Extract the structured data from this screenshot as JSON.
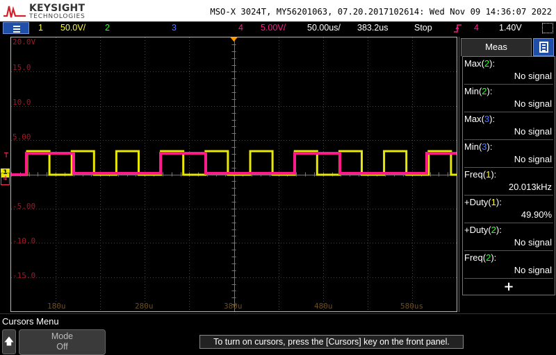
{
  "header": {
    "brand": "KEYSIGHT",
    "brand_sub": "TECHNOLOGIES",
    "instrument": "MSO-X 3024T, MY56201063, 07.20.2017102614: Wed Nov 09 14:36:07 2022"
  },
  "status_bar": {
    "ch1_num": "1",
    "ch1_scale": "50.0V/",
    "ch2_num": "2",
    "ch3_num": "3",
    "ch4_num": "4",
    "ch4_scale": "5.00V/",
    "timebase": "50.00us/",
    "delay": "383.2us",
    "run_state": "Stop",
    "trigger_channel": "4",
    "trigger_level": "1.40V"
  },
  "graticule": {
    "y_labels": [
      "20.0V",
      "15.0",
      "10.0",
      "5.00",
      "-5.00",
      "-10.0",
      "-15.0"
    ],
    "x_labels": [
      "180u",
      "280u",
      "380u",
      "480u",
      "580us"
    ],
    "ch1_marker": "1",
    "ch4_marker": "4",
    "trig_marker": "T"
  },
  "colors": {
    "ch1": "#ffff33",
    "ch2": "#33ff33",
    "ch3": "#5577ff",
    "ch4": "#ff1a8c",
    "menu_button": "#1f4fa8"
  },
  "measurements": {
    "tab_label": "Meas",
    "items": [
      {
        "name": "Max",
        "ch": "2",
        "value": "No signal"
      },
      {
        "name": "Min",
        "ch": "2",
        "value": "No signal"
      },
      {
        "name": "Max",
        "ch": "3",
        "value": "No signal"
      },
      {
        "name": "Min",
        "ch": "3",
        "value": "No signal"
      },
      {
        "name": "Freq",
        "ch": "1",
        "value": "20.013kHz"
      },
      {
        "name": "+Duty",
        "ch": "1",
        "value": "49.90%"
      },
      {
        "name": "+Duty",
        "ch": "2",
        "value": "No signal"
      },
      {
        "name": "Freq",
        "ch": "2",
        "value": "No signal"
      }
    ],
    "add_label": "+"
  },
  "bottom": {
    "menu_title": "Cursors Menu",
    "home_icon": "up-arrow-icon",
    "softkey_label": "Mode",
    "softkey_value": "Off",
    "hint": "To turn on cursors, press the [Cursors] key on the front panel."
  }
}
